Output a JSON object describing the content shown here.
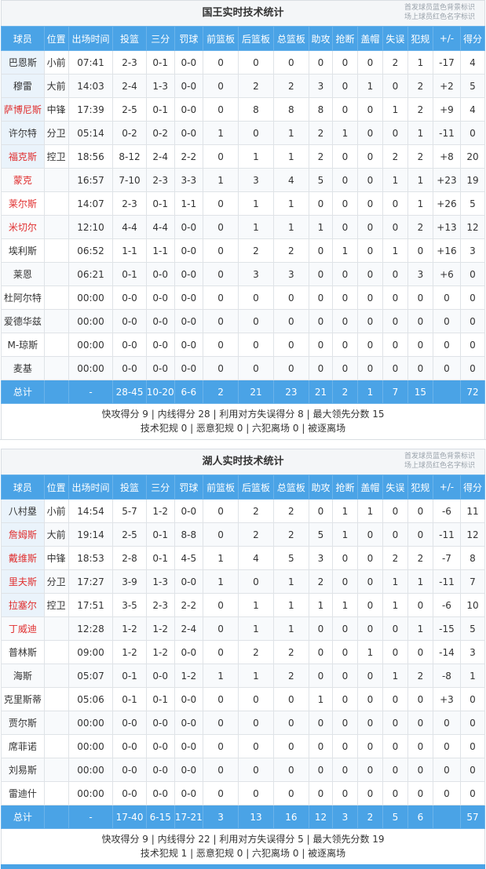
{
  "columns": [
    "球员",
    "位置",
    "出场时间",
    "投篮",
    "三分",
    "罚球",
    "前篮板",
    "后篮板",
    "总篮板",
    "助攻",
    "抢断",
    "盖帽",
    "失误",
    "犯规",
    "+/-",
    "得分"
  ],
  "legend": [
    "首发球员蓝色背景标识",
    "场上球员红色名字标识"
  ],
  "teams": [
    {
      "title": "国王实时技术统计",
      "players": [
        {
          "name": "巴恩斯",
          "pos": "小前",
          "min": "07:41",
          "fg": "2-3",
          "tp": "0-1",
          "ft": "0-0",
          "oreb": "0",
          "dreb": "0",
          "reb": "0",
          "ast": "0",
          "stl": "0",
          "blk": "0",
          "tov": "2",
          "pf": "1",
          "pm": "-17",
          "pts": "4",
          "starter": true,
          "on_court": false
        },
        {
          "name": "穆雷",
          "pos": "大前",
          "min": "14:03",
          "fg": "2-4",
          "tp": "1-3",
          "ft": "0-0",
          "oreb": "0",
          "dreb": "2",
          "reb": "2",
          "ast": "3",
          "stl": "0",
          "blk": "1",
          "tov": "0",
          "pf": "2",
          "pm": "+2",
          "pts": "5",
          "starter": true,
          "on_court": false
        },
        {
          "name": "萨博尼斯",
          "pos": "中锋",
          "min": "17:39",
          "fg": "2-5",
          "tp": "0-1",
          "ft": "0-0",
          "oreb": "0",
          "dreb": "8",
          "reb": "8",
          "ast": "8",
          "stl": "0",
          "blk": "0",
          "tov": "1",
          "pf": "2",
          "pm": "+9",
          "pts": "4",
          "starter": true,
          "on_court": true
        },
        {
          "name": "许尔特",
          "pos": "分卫",
          "min": "05:14",
          "fg": "0-2",
          "tp": "0-2",
          "ft": "0-0",
          "oreb": "1",
          "dreb": "0",
          "reb": "1",
          "ast": "2",
          "stl": "1",
          "blk": "0",
          "tov": "0",
          "pf": "1",
          "pm": "-11",
          "pts": "0",
          "starter": true,
          "on_court": false
        },
        {
          "name": "福克斯",
          "pos": "控卫",
          "min": "18:56",
          "fg": "8-12",
          "tp": "2-4",
          "ft": "2-2",
          "oreb": "0",
          "dreb": "1",
          "reb": "1",
          "ast": "2",
          "stl": "0",
          "blk": "0",
          "tov": "2",
          "pf": "2",
          "pm": "+8",
          "pts": "20",
          "starter": true,
          "on_court": true
        },
        {
          "name": "蒙克",
          "pos": "",
          "min": "16:57",
          "fg": "7-10",
          "tp": "2-3",
          "ft": "3-3",
          "oreb": "1",
          "dreb": "3",
          "reb": "4",
          "ast": "5",
          "stl": "0",
          "blk": "0",
          "tov": "1",
          "pf": "1",
          "pm": "+23",
          "pts": "19",
          "starter": false,
          "on_court": true
        },
        {
          "name": "莱尔斯",
          "pos": "",
          "min": "14:07",
          "fg": "2-3",
          "tp": "0-1",
          "ft": "1-1",
          "oreb": "0",
          "dreb": "1",
          "reb": "1",
          "ast": "0",
          "stl": "0",
          "blk": "0",
          "tov": "0",
          "pf": "1",
          "pm": "+26",
          "pts": "5",
          "starter": false,
          "on_court": true
        },
        {
          "name": "米切尔",
          "pos": "",
          "min": "12:10",
          "fg": "4-4",
          "tp": "4-4",
          "ft": "0-0",
          "oreb": "0",
          "dreb": "1",
          "reb": "1",
          "ast": "1",
          "stl": "0",
          "blk": "0",
          "tov": "0",
          "pf": "2",
          "pm": "+13",
          "pts": "12",
          "starter": false,
          "on_court": true
        },
        {
          "name": "埃利斯",
          "pos": "",
          "min": "06:52",
          "fg": "1-1",
          "tp": "1-1",
          "ft": "0-0",
          "oreb": "0",
          "dreb": "2",
          "reb": "2",
          "ast": "0",
          "stl": "1",
          "blk": "0",
          "tov": "1",
          "pf": "0",
          "pm": "+16",
          "pts": "3",
          "starter": false,
          "on_court": false
        },
        {
          "name": "莱恩",
          "pos": "",
          "min": "06:21",
          "fg": "0-1",
          "tp": "0-0",
          "ft": "0-0",
          "oreb": "0",
          "dreb": "3",
          "reb": "3",
          "ast": "0",
          "stl": "0",
          "blk": "0",
          "tov": "0",
          "pf": "3",
          "pm": "+6",
          "pts": "0",
          "starter": false,
          "on_court": false
        },
        {
          "name": "杜阿尔特",
          "pos": "",
          "min": "00:00",
          "fg": "0-0",
          "tp": "0-0",
          "ft": "0-0",
          "oreb": "0",
          "dreb": "0",
          "reb": "0",
          "ast": "0",
          "stl": "0",
          "blk": "0",
          "tov": "0",
          "pf": "0",
          "pm": "0",
          "pts": "0",
          "starter": false,
          "on_court": false
        },
        {
          "name": "爱德华兹",
          "pos": "",
          "min": "00:00",
          "fg": "0-0",
          "tp": "0-0",
          "ft": "0-0",
          "oreb": "0",
          "dreb": "0",
          "reb": "0",
          "ast": "0",
          "stl": "0",
          "blk": "0",
          "tov": "0",
          "pf": "0",
          "pm": "0",
          "pts": "0",
          "starter": false,
          "on_court": false
        },
        {
          "name": "M-琼斯",
          "pos": "",
          "min": "00:00",
          "fg": "0-0",
          "tp": "0-0",
          "ft": "0-0",
          "oreb": "0",
          "dreb": "0",
          "reb": "0",
          "ast": "0",
          "stl": "0",
          "blk": "0",
          "tov": "0",
          "pf": "0",
          "pm": "0",
          "pts": "0",
          "starter": false,
          "on_court": false
        },
        {
          "name": "麦基",
          "pos": "",
          "min": "00:00",
          "fg": "0-0",
          "tp": "0-0",
          "ft": "0-0",
          "oreb": "0",
          "dreb": "0",
          "reb": "0",
          "ast": "0",
          "stl": "0",
          "blk": "0",
          "tov": "0",
          "pf": "0",
          "pm": "0",
          "pts": "0",
          "starter": false,
          "on_court": false
        }
      ],
      "totals": {
        "name": "总计",
        "pos": "",
        "min": "-",
        "fg": "28-45",
        "tp": "10-20",
        "ft": "6-6",
        "oreb": "2",
        "dreb": "21",
        "reb": "23",
        "ast": "21",
        "stl": "2",
        "blk": "1",
        "tov": "7",
        "pf": "15",
        "pm": "",
        "pts": "72"
      },
      "summary_line1": "快攻得分 9 | 内线得分 28 | 利用对方失误得分 8 | 最大领先分数 15",
      "summary_line2": "技术犯规 0 | 恶意犯规 0 | 六犯离场 0 | 被逐离场"
    },
    {
      "title": "湖人实时技术统计",
      "players": [
        {
          "name": "八村塁",
          "pos": "小前",
          "min": "14:54",
          "fg": "5-7",
          "tp": "1-2",
          "ft": "0-0",
          "oreb": "0",
          "dreb": "2",
          "reb": "2",
          "ast": "0",
          "stl": "1",
          "blk": "1",
          "tov": "0",
          "pf": "0",
          "pm": "-6",
          "pts": "11",
          "starter": true,
          "on_court": false
        },
        {
          "name": "詹姆斯",
          "pos": "大前",
          "min": "19:14",
          "fg": "2-5",
          "tp": "0-1",
          "ft": "8-8",
          "oreb": "0",
          "dreb": "2",
          "reb": "2",
          "ast": "5",
          "stl": "1",
          "blk": "0",
          "tov": "0",
          "pf": "0",
          "pm": "-11",
          "pts": "12",
          "starter": true,
          "on_court": true
        },
        {
          "name": "戴维斯",
          "pos": "中锋",
          "min": "18:53",
          "fg": "2-8",
          "tp": "0-1",
          "ft": "4-5",
          "oreb": "1",
          "dreb": "4",
          "reb": "5",
          "ast": "3",
          "stl": "0",
          "blk": "0",
          "tov": "2",
          "pf": "2",
          "pm": "-7",
          "pts": "8",
          "starter": true,
          "on_court": true
        },
        {
          "name": "里夫斯",
          "pos": "分卫",
          "min": "17:27",
          "fg": "3-9",
          "tp": "1-3",
          "ft": "0-0",
          "oreb": "1",
          "dreb": "0",
          "reb": "1",
          "ast": "2",
          "stl": "0",
          "blk": "0",
          "tov": "1",
          "pf": "1",
          "pm": "-11",
          "pts": "7",
          "starter": true,
          "on_court": true
        },
        {
          "name": "拉塞尔",
          "pos": "控卫",
          "min": "17:51",
          "fg": "3-5",
          "tp": "2-3",
          "ft": "2-2",
          "oreb": "0",
          "dreb": "1",
          "reb": "1",
          "ast": "1",
          "stl": "1",
          "blk": "0",
          "tov": "1",
          "pf": "0",
          "pm": "-6",
          "pts": "10",
          "starter": true,
          "on_court": true
        },
        {
          "name": "丁威迪",
          "pos": "",
          "min": "12:28",
          "fg": "1-2",
          "tp": "1-2",
          "ft": "2-4",
          "oreb": "0",
          "dreb": "1",
          "reb": "1",
          "ast": "0",
          "stl": "0",
          "blk": "0",
          "tov": "0",
          "pf": "1",
          "pm": "-15",
          "pts": "5",
          "starter": false,
          "on_court": true
        },
        {
          "name": "普林斯",
          "pos": "",
          "min": "09:00",
          "fg": "1-2",
          "tp": "1-2",
          "ft": "0-0",
          "oreb": "0",
          "dreb": "2",
          "reb": "2",
          "ast": "0",
          "stl": "0",
          "blk": "1",
          "tov": "0",
          "pf": "0",
          "pm": "-14",
          "pts": "3",
          "starter": false,
          "on_court": false
        },
        {
          "name": "海斯",
          "pos": "",
          "min": "05:07",
          "fg": "0-1",
          "tp": "0-0",
          "ft": "1-2",
          "oreb": "1",
          "dreb": "1",
          "reb": "2",
          "ast": "0",
          "stl": "0",
          "blk": "0",
          "tov": "1",
          "pf": "2",
          "pm": "-8",
          "pts": "1",
          "starter": false,
          "on_court": false
        },
        {
          "name": "克里斯蒂",
          "pos": "",
          "min": "05:06",
          "fg": "0-1",
          "tp": "0-1",
          "ft": "0-0",
          "oreb": "0",
          "dreb": "0",
          "reb": "0",
          "ast": "1",
          "stl": "0",
          "blk": "0",
          "tov": "0",
          "pf": "0",
          "pm": "+3",
          "pts": "0",
          "starter": false,
          "on_court": false
        },
        {
          "name": "贾尔斯",
          "pos": "",
          "min": "00:00",
          "fg": "0-0",
          "tp": "0-0",
          "ft": "0-0",
          "oreb": "0",
          "dreb": "0",
          "reb": "0",
          "ast": "0",
          "stl": "0",
          "blk": "0",
          "tov": "0",
          "pf": "0",
          "pm": "0",
          "pts": "0",
          "starter": false,
          "on_court": false
        },
        {
          "name": "席菲诺",
          "pos": "",
          "min": "00:00",
          "fg": "0-0",
          "tp": "0-0",
          "ft": "0-0",
          "oreb": "0",
          "dreb": "0",
          "reb": "0",
          "ast": "0",
          "stl": "0",
          "blk": "0",
          "tov": "0",
          "pf": "0",
          "pm": "0",
          "pts": "0",
          "starter": false,
          "on_court": false
        },
        {
          "name": "刘易斯",
          "pos": "",
          "min": "00:00",
          "fg": "0-0",
          "tp": "0-0",
          "ft": "0-0",
          "oreb": "0",
          "dreb": "0",
          "reb": "0",
          "ast": "0",
          "stl": "0",
          "blk": "0",
          "tov": "0",
          "pf": "0",
          "pm": "0",
          "pts": "0",
          "starter": false,
          "on_court": false
        },
        {
          "name": "雷迪什",
          "pos": "",
          "min": "00:00",
          "fg": "0-0",
          "tp": "0-0",
          "ft": "0-0",
          "oreb": "0",
          "dreb": "0",
          "reb": "0",
          "ast": "0",
          "stl": "0",
          "blk": "0",
          "tov": "0",
          "pf": "0",
          "pm": "0",
          "pts": "0",
          "starter": false,
          "on_court": false
        }
      ],
      "totals": {
        "name": "总计",
        "pos": "",
        "min": "-",
        "fg": "17-40",
        "tp": "6-15",
        "ft": "17-21",
        "oreb": "3",
        "dreb": "13",
        "reb": "16",
        "ast": "12",
        "stl": "3",
        "blk": "2",
        "tov": "5",
        "pf": "6",
        "pm": "",
        "pts": "57"
      },
      "summary_line1": "快攻得分 9 | 内线得分 22 | 利用对方失误得分 5 | 最大领先分数 19",
      "summary_line2": "技术犯规 1 | 恶意犯规 0 | 六犯离场 0 | 被逐离场"
    }
  ]
}
